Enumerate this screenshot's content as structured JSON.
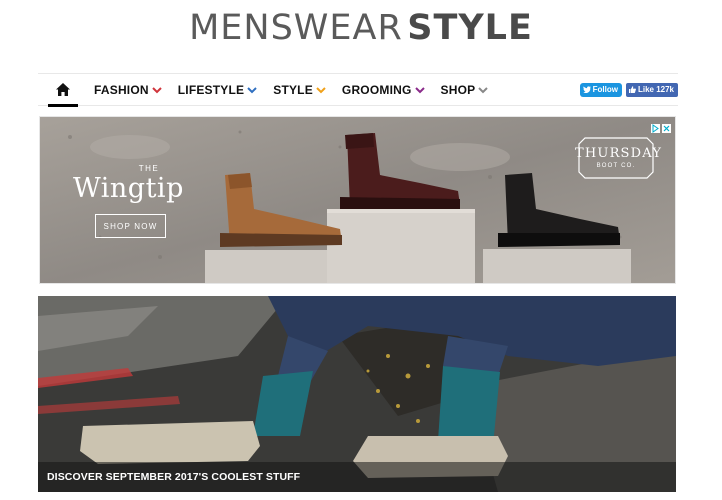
{
  "logo": {
    "part1": "MENSWEAR",
    "part2": "STYLE"
  },
  "nav": {
    "items": [
      {
        "label": "FASHION",
        "chevron_color": "#d0343b"
      },
      {
        "label": "LIFESTYLE",
        "chevron_color": "#2f6fc0"
      },
      {
        "label": "STYLE",
        "chevron_color": "#f0a11a"
      },
      {
        "label": "GROOMING",
        "chevron_color": "#8a2a8a"
      },
      {
        "label": "SHOP",
        "chevron_color": "#888888"
      }
    ],
    "home_icon": "home-icon",
    "twitter_label": "Follow",
    "facebook_label": "Like 127k"
  },
  "ad": {
    "title_small": "THE",
    "title": "Wingtip",
    "button_label": "SHOP NOW",
    "brand_line1": "THURSDAY",
    "brand_line2": "BOOT CO."
  },
  "hero": {
    "caption": "DISCOVER SEPTEMBER 2017'S COOLEST STUFF"
  }
}
